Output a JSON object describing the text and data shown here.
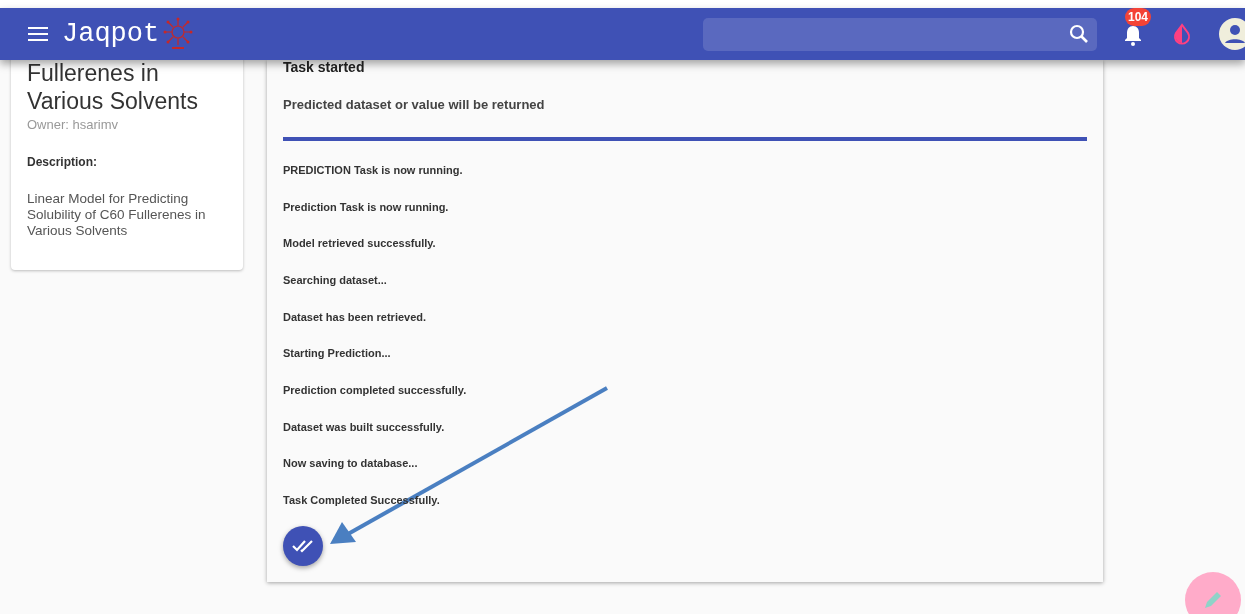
{
  "navbar": {
    "title": "Jaqpot",
    "notifications_badge": "104"
  },
  "model_card": {
    "title": "Fullerenes in Various Solvents",
    "owner": "Owner: hsarimv",
    "description_label": "Description:",
    "description": "Linear Model for Predicting Solubility of C60 Fullerenes in Various Solvents"
  },
  "task_dialog": {
    "title": "Task started",
    "subtitle": "Predicted dataset or value will be returned",
    "progress": {
      "level": 1
    },
    "messages": [
      "PREDICTION Task is now running.",
      "Prediction Task is now running.",
      "Model retrieved successfully.",
      "Searching dataset...",
      "Dataset has been retrieved.",
      "Starting Prediction...",
      "Prediction completed successfully.",
      "Dataset was built successfully.",
      "Now saving to database...",
      "Task Completed Successfully."
    ]
  }
}
